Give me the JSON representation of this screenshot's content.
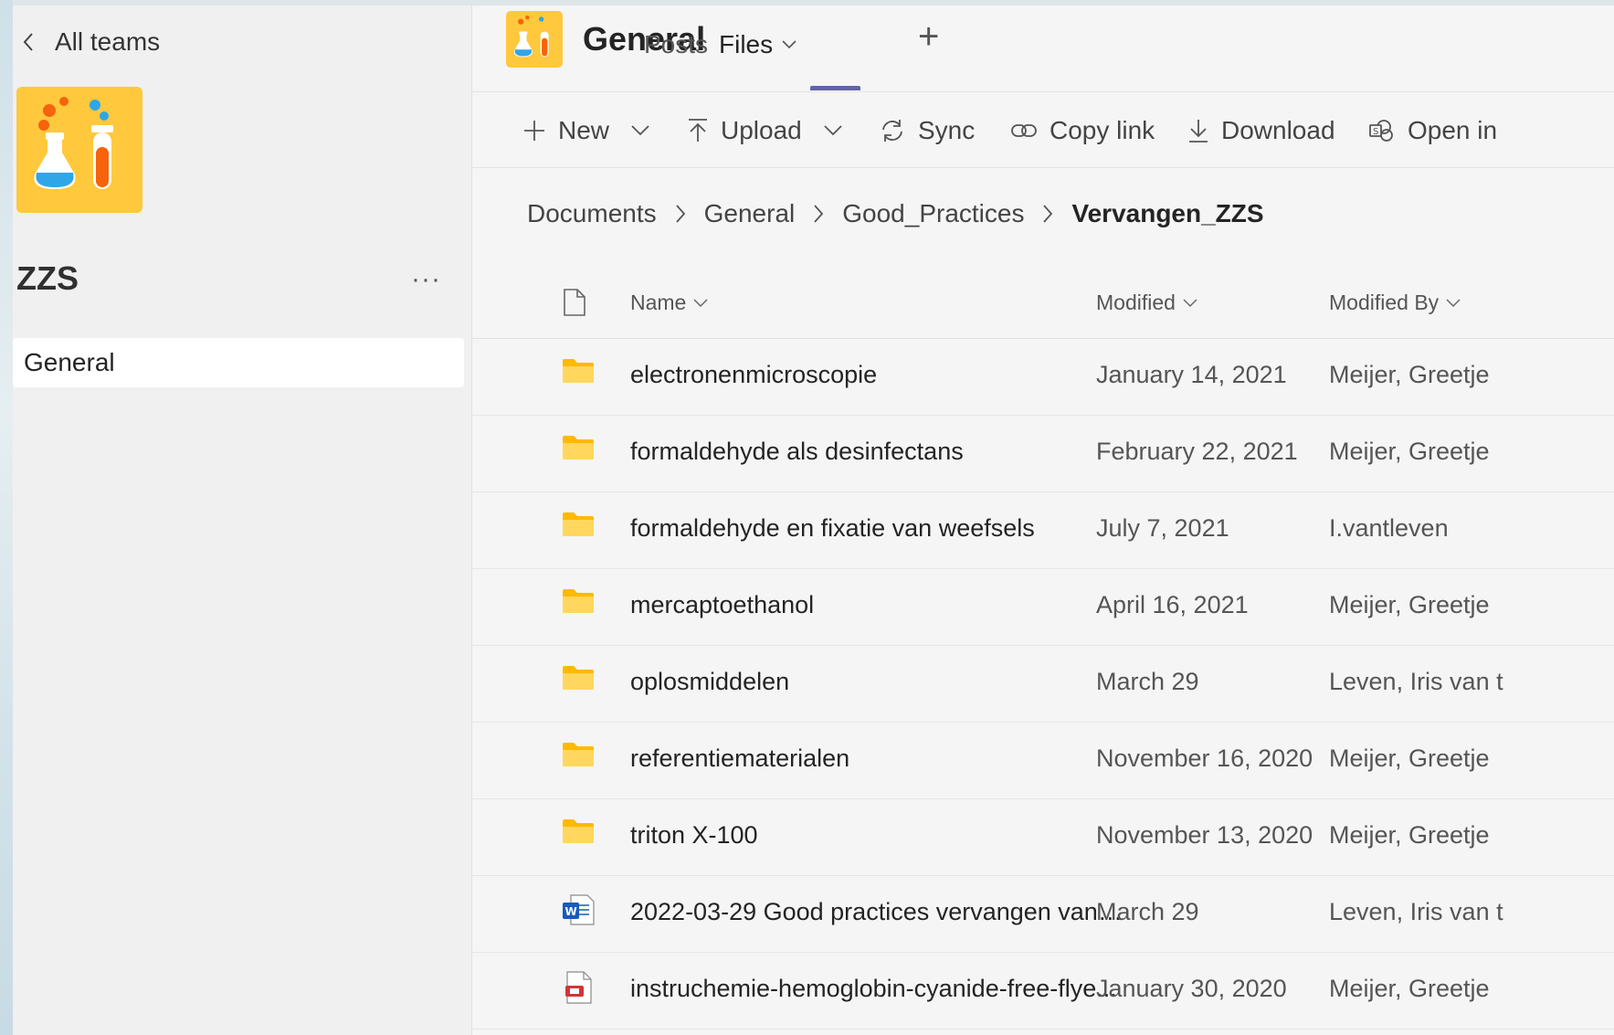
{
  "sidebar": {
    "back_label": "All teams",
    "team_name": "ZZS",
    "more_label": "···",
    "channels": [
      {
        "label": "General"
      }
    ]
  },
  "header": {
    "channel_title": "General",
    "tabs": [
      {
        "label": "Posts"
      },
      {
        "label": "Files"
      }
    ],
    "add_tab_label": "+"
  },
  "toolbar": {
    "new_label": "New",
    "upload_label": "Upload",
    "sync_label": "Sync",
    "copy_link_label": "Copy link",
    "download_label": "Download",
    "open_in_label": "Open in"
  },
  "breadcrumb": [
    "Documents",
    "General",
    "Good_Practices",
    "Vervangen_ZZS"
  ],
  "list": {
    "columns": {
      "name": "Name",
      "modified": "Modified",
      "modified_by": "Modified By"
    },
    "rows": [
      {
        "type": "folder",
        "name": "electronenmicroscopie",
        "modified": "January 14, 2021",
        "modified_by": "Meijer, Greetje"
      },
      {
        "type": "folder",
        "name": "formaldehyde als desinfectans",
        "modified": "February 22, 2021",
        "modified_by": "Meijer, Greetje"
      },
      {
        "type": "folder",
        "name": "formaldehyde en fixatie van weefsels",
        "modified": "July 7, 2021",
        "modified_by": "I.vantleven"
      },
      {
        "type": "folder",
        "name": "mercaptoethanol",
        "modified": "April 16, 2021",
        "modified_by": "Meijer, Greetje"
      },
      {
        "type": "folder",
        "name": "oplosmiddelen",
        "modified": "March 29",
        "modified_by": "Leven, Iris van t"
      },
      {
        "type": "folder",
        "name": "referentiematerialen",
        "modified": "November 16, 2020",
        "modified_by": "Meijer, Greetje"
      },
      {
        "type": "folder",
        "name": "triton X-100",
        "modified": "November 13, 2020",
        "modified_by": "Meijer, Greetje"
      },
      {
        "type": "word",
        "name": "2022-03-29 Good practices vervangen van ...",
        "modified": "March 29",
        "modified_by": "Leven, Iris van t"
      },
      {
        "type": "pdf",
        "name": "instruchemie-hemoglobin-cyanide-free-flye...",
        "modified": "January 30, 2020",
        "modified_by": "Meijer, Greetje"
      }
    ]
  },
  "colors": {
    "accent": "#6264a7",
    "folder": "#ffc83d",
    "team_icon_bg": "#ffc83d",
    "word_blue": "#185abd",
    "pdf_red": "#d13438"
  }
}
